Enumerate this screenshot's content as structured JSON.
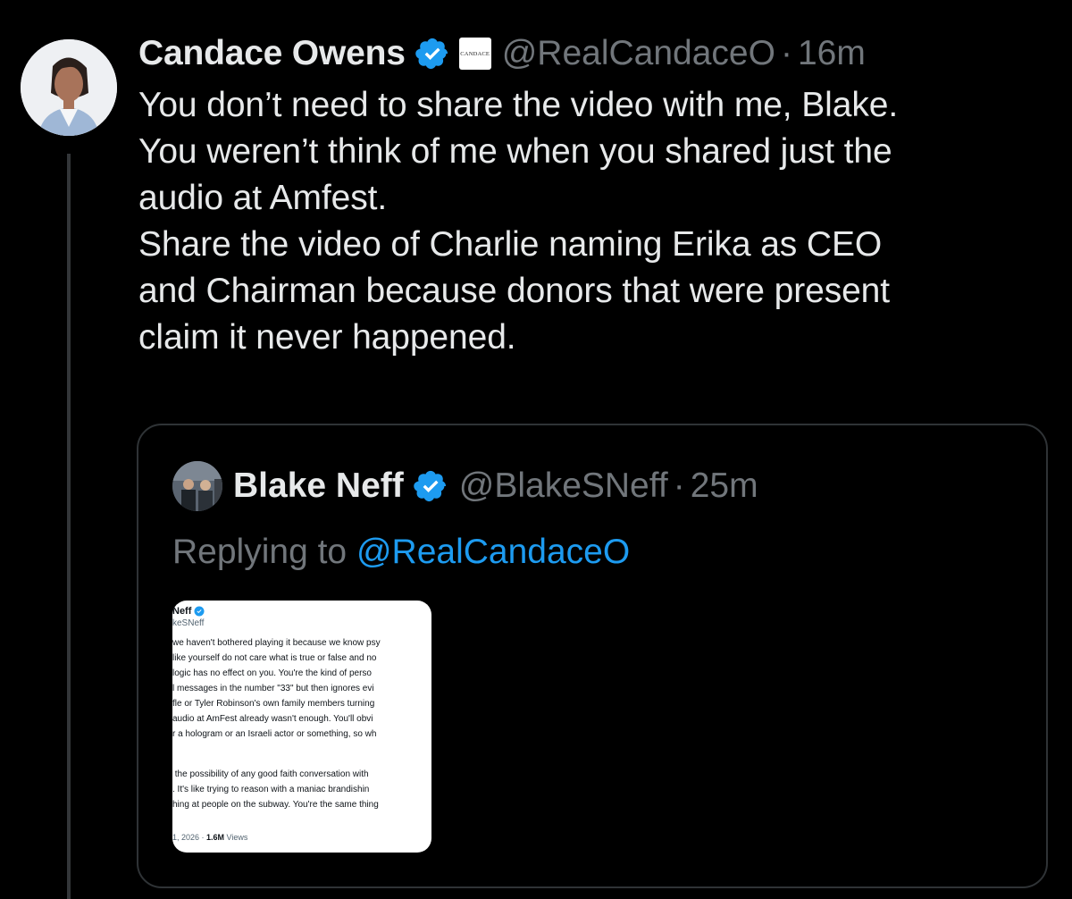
{
  "tweet": {
    "author_name": "Candace Owens",
    "affiliate_badge": "CANDACE",
    "handle": "@RealCandaceO",
    "separator": "·",
    "time": "16m",
    "text": "You don’t need to share the video with me, Blake.\nYou weren’t think of me when you shared just the\naudio at Amfest.\nShare the video of Charlie naming Erika as CEO\nand Chairman because donors that were present\nclaim it never happened."
  },
  "quoted": {
    "author_name": "Blake Neff",
    "handle": "@BlakeSNeff",
    "separator": "·",
    "time": "25m",
    "replying_prefix": "Replying to ",
    "replying_to": "@RealCandaceO",
    "media": {
      "name": "Neff",
      "handle": "keSNeff",
      "paragraph1": "we haven't bothered playing it because we know psy\nlike yourself do not care what is true or false and no\nlogic has no effect on you. You're the kind of perso\nl messages in the number \"33\" but then ignores evi\nfle or Tyler Robinson's own family members turning\naudio at AmFest already wasn't enough. You'll obvi\nr a hologram or an Israeli actor or something, so wh",
      "paragraph2": " the possibility of any good faith conversation with\n. It's like trying to reason with a maniac brandishin\nhing at people on the subway. You're the same thing",
      "footer_date": "1, 2026 · ",
      "footer_views_count": "1.6M",
      "footer_views_label": " Views"
    }
  },
  "colors": {
    "background": "#000000",
    "text_primary": "#e7e9ea",
    "text_secondary": "#71767b",
    "link": "#1d9bf0",
    "verified": "#1d9bf0",
    "border": "#2f3336"
  }
}
